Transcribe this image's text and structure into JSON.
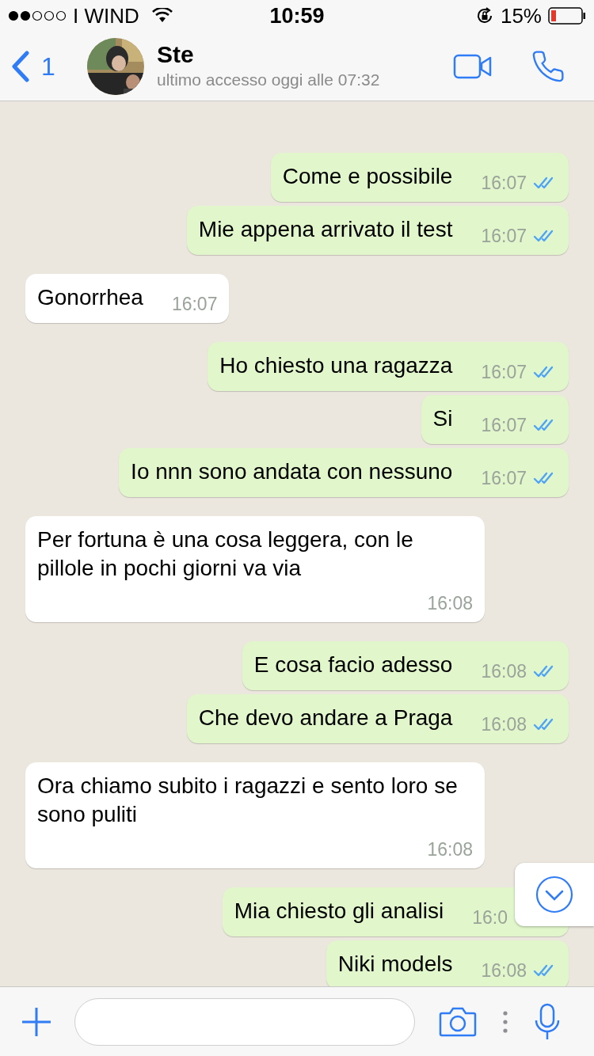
{
  "status_bar": {
    "carrier": "I WIND",
    "time": "10:59",
    "battery": "15%"
  },
  "header": {
    "back_count": "1",
    "name": "Ste",
    "last_seen": "ultimo accesso oggi alle 07:32"
  },
  "messages": [
    {
      "kind": "out",
      "text": "Come e possibile",
      "time": "16:07",
      "read": true
    },
    {
      "kind": "out",
      "text": "Mie appena arrivato il test",
      "time": "16:07",
      "read": true
    },
    {
      "kind": "in",
      "text": "Gonorrhea",
      "time": "16:07"
    },
    {
      "kind": "out",
      "text": "Ho chiesto una ragazza",
      "time": "16:07",
      "read": true
    },
    {
      "kind": "out",
      "text": "Si",
      "time": "16:07",
      "read": true
    },
    {
      "kind": "out",
      "text": "Io nnn sono andata con nessuno",
      "time": "16:07",
      "read": true
    },
    {
      "kind": "in",
      "text": "Per fortuna è una cosa leggera, con le pillole in pochi giorni va via",
      "time": "16:08"
    },
    {
      "kind": "out",
      "text": "E cosa facio adesso",
      "time": "16:08",
      "read": true
    },
    {
      "kind": "out",
      "text": "Che devo andare a Praga",
      "time": "16:08",
      "read": true
    },
    {
      "kind": "in",
      "text": "Ora chiamo subito i ragazzi e sento loro se sono puliti",
      "time": "16:08"
    },
    {
      "kind": "out",
      "text": "Mia chiesto gli analisi",
      "time": "16:0"
    },
    {
      "kind": "out",
      "text": "Niki models",
      "time": "16:08",
      "read": true
    }
  ]
}
